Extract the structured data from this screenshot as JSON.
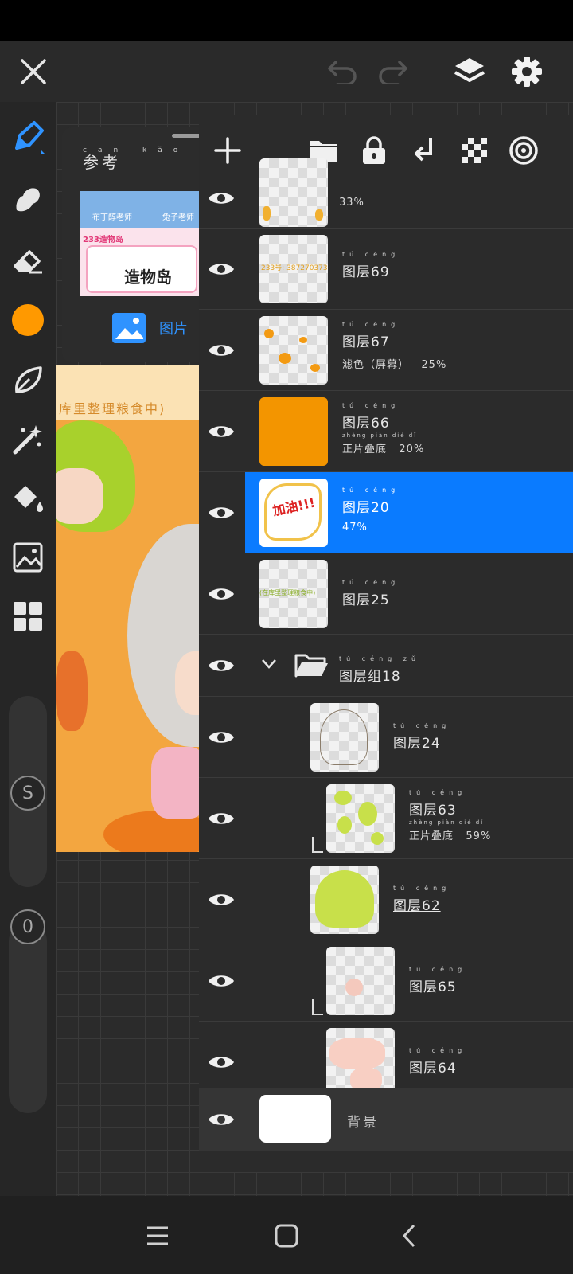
{
  "colors": {
    "accent": "#0a7bff",
    "brush": "#ff9900",
    "panel": "#2b2b2b",
    "artwork_orange": "#f3a640"
  },
  "topbar": {
    "close_icon": "close-icon",
    "undo_icon": "undo-icon",
    "redo_icon": "redo-icon",
    "layers_icon": "layers-icon",
    "settings_icon": "gear-icon"
  },
  "tools": [
    "brush-icon",
    "smudge-icon",
    "eraser-icon",
    "color-swatch",
    "leaf-brush-icon",
    "magic-wand-icon",
    "fill-bucket-icon",
    "image-edit-icon",
    "grid-icon"
  ],
  "sliders": {
    "size_badge": "S",
    "opacity_badge": "0"
  },
  "reference": {
    "title": "参考",
    "title_pinyin": "cān kǎo",
    "image_button_label": "图片",
    "thumb_texts": [
      "布丁醇老师",
      "兔子老师",
      "233造物岛",
      "造物岛"
    ]
  },
  "artwork": {
    "caption": "库里整理粮食中)"
  },
  "layer_toolbar": [
    "add-icon",
    "folder-icon",
    "lock-icon",
    "merge-down-icon",
    "transparency-icon",
    "target-icon"
  ],
  "layers": [
    {
      "name": "",
      "sub": "33%",
      "pinyin": ""
    },
    {
      "name": "图层69",
      "sub": "",
      "pinyin": "tú céng",
      "thumb_text": "233号: 387270373"
    },
    {
      "name": "图层67",
      "sub": "滤色（屏幕）   25%",
      "pinyin": "tú céng"
    },
    {
      "name": "图层66",
      "sub": "正片叠底   20%",
      "pinyin": "tú céng",
      "sub_pinyin": "zhèng piàn dié dǐ"
    },
    {
      "name": "图层20",
      "sub": "47%",
      "pinyin": "tú céng",
      "thumb_text": "加油!!!"
    },
    {
      "name": "图层25",
      "sub": "",
      "pinyin": "tú céng",
      "thumb_text": "(在库里整理粮食中)"
    },
    {
      "name": "图层组18",
      "sub": "",
      "pinyin": "tú céng zǔ"
    },
    {
      "name": "图层24",
      "sub": "",
      "pinyin": "tú céng"
    },
    {
      "name": "图层63",
      "sub": "正片叠底   59%",
      "pinyin": "tú céng",
      "sub_pinyin": "zhèng piàn dié dǐ"
    },
    {
      "name": "图层62",
      "sub": "",
      "pinyin": "tú céng"
    },
    {
      "name": "图层65",
      "sub": "",
      "pinyin": "tú céng"
    },
    {
      "name": "图层64",
      "sub": "",
      "pinyin": "tú céng"
    }
  ],
  "background_layer": {
    "name": "背景"
  },
  "navbar": [
    "menu-icon",
    "home-icon",
    "back-icon"
  ]
}
